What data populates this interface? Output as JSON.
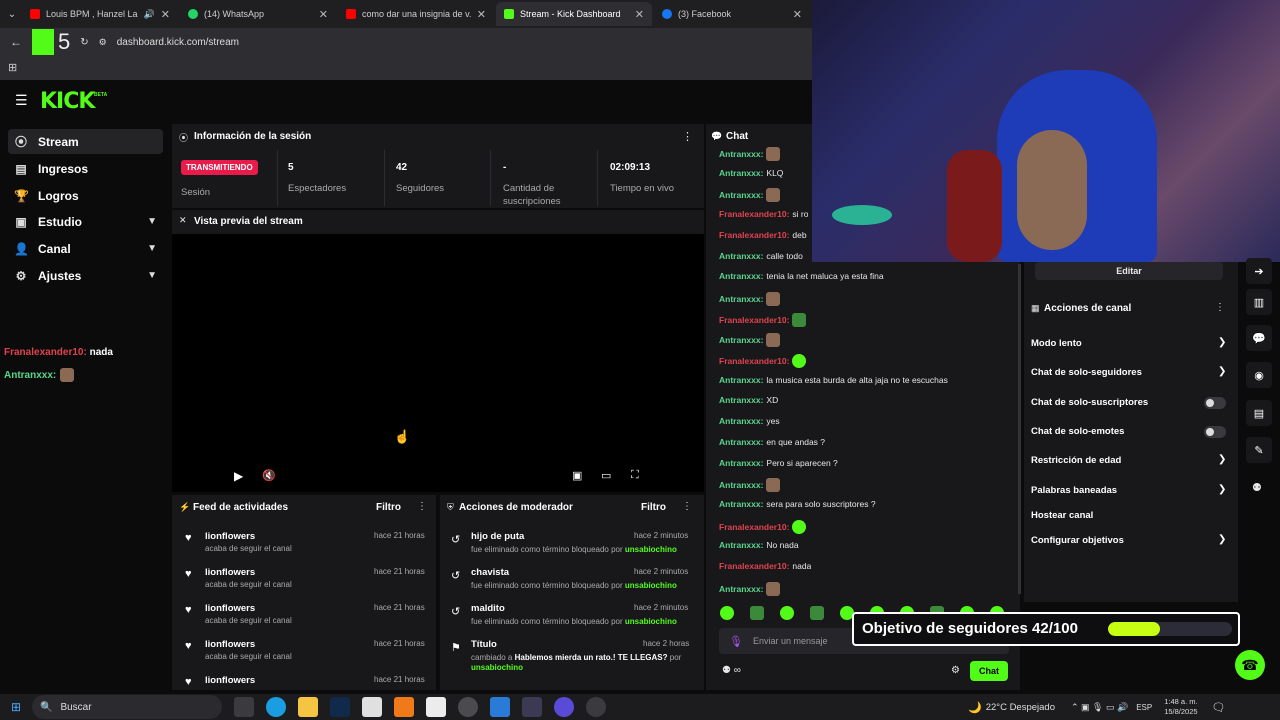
{
  "browser": {
    "tabs": [
      {
        "title": "Louis BPM , Hanzel La H, J...",
        "color": "#ff0000"
      },
      {
        "title": "(14) WhatsApp",
        "color": "#25d366"
      },
      {
        "title": "como dar una insignia de v...",
        "color": "#ff0000"
      },
      {
        "title": "Stream - Kick Dashboard",
        "color": "#53fc18"
      },
      {
        "title": "(3) Facebook",
        "color": "#1877f2"
      }
    ],
    "url": "dashboard.kick.com/stream",
    "overlay_number": "5"
  },
  "brand": {
    "logo": "KICK",
    "beta": "BETA",
    "accent": "#53fc18"
  },
  "sidebar": {
    "items": [
      {
        "label": "Stream",
        "icon": "broadcast-icon"
      },
      {
        "label": "Ingresos",
        "icon": "revenue-icon"
      },
      {
        "label": "Logros",
        "icon": "trophy-icon"
      },
      {
        "label": "Estudio",
        "icon": "studio-icon"
      },
      {
        "label": "Canal",
        "icon": "channel-icon"
      },
      {
        "label": "Ajustes",
        "icon": "gear-icon"
      }
    ]
  },
  "overlay_chat": [
    {
      "user": "Franalexander10:",
      "text": "nada"
    },
    {
      "user": "Antranxxx:",
      "text": ""
    }
  ],
  "session": {
    "title": "Información de la sesión",
    "live_badge": "TRANSMITIENDO",
    "live_label": "Sesión",
    "stats": [
      {
        "value": "5",
        "label": "Espectadores"
      },
      {
        "value": "42",
        "label": "Seguidores"
      },
      {
        "value": "-",
        "label": "Cantidad de suscripciones"
      },
      {
        "value": "02:09:13",
        "label": "Tiempo en vivo"
      }
    ]
  },
  "preview": {
    "title": "Vista previa del stream"
  },
  "feed": {
    "title": "Feed de actividades",
    "filter": "Filtro",
    "rows": [
      {
        "user": "lionflowers",
        "sub": "acaba de seguir el canal",
        "time": "hace 21 horas"
      },
      {
        "user": "lionflowers",
        "sub": "acaba de seguir el canal",
        "time": "hace 21 horas"
      },
      {
        "user": "lionflowers",
        "sub": "acaba de seguir el canal",
        "time": "hace 21 horas"
      },
      {
        "user": "lionflowers",
        "sub": "acaba de seguir el canal",
        "time": "hace 21 horas"
      },
      {
        "user": "lionflowers",
        "sub": "",
        "time": "hace 21 horas"
      }
    ]
  },
  "mod": {
    "title": "Acciones de moderador",
    "filter": "Filtro",
    "rows": [
      {
        "title": "hijo de puta",
        "sub": "fue eliminado como término bloqueado por",
        "by": "unsabiochino",
        "time": "hace 2 minutos"
      },
      {
        "title": "chavista",
        "sub": "fue eliminado como término bloqueado por",
        "by": "unsabiochino",
        "time": "hace 2 minutos"
      },
      {
        "title": "maldito",
        "sub": "fue eliminado como término bloqueado por",
        "by": "unsabiochino",
        "time": "hace 2 minutos"
      },
      {
        "title": "Título",
        "sub": "cambiado a",
        "sub_bold": "Hablemos mierda un rato.! TE LLEGAS?",
        "sub_end": "por",
        "by": "unsabiochino",
        "time": "hace 2 horas"
      }
    ]
  },
  "chat": {
    "title": "Chat",
    "messages": [
      {
        "user": "Antranxxx:",
        "color": "g",
        "text": "",
        "emote": "face"
      },
      {
        "user": "Antranxxx:",
        "color": "g",
        "text": "KLQ"
      },
      {
        "user": "Antranxxx:",
        "color": "g",
        "text": "",
        "emote": "face"
      },
      {
        "user": "Franalexander10:",
        "color": "r",
        "text": "si ro"
      },
      {
        "user": "Franalexander10:",
        "color": "r",
        "text": "deb"
      },
      {
        "user": "Antranxxx:",
        "color": "g",
        "text": "calle todo"
      },
      {
        "user": "Antranxxx:",
        "color": "g",
        "text": "tenia la net maluca ya esta fina"
      },
      {
        "user": "Antranxxx:",
        "color": "g",
        "text": "",
        "emote": "face"
      },
      {
        "user": "Franalexander10:",
        "color": "r",
        "text": "",
        "emote": "sq"
      },
      {
        "user": "Antranxxx:",
        "color": "g",
        "text": "",
        "emote": "face"
      },
      {
        "user": "Franalexander10:",
        "color": "r",
        "text": "",
        "emote": "green"
      },
      {
        "user": "Antranxxx:",
        "color": "g",
        "text": "la musica esta burda de alta jaja no te escuchas"
      },
      {
        "user": "Antranxxx:",
        "color": "g",
        "text": "XD"
      },
      {
        "user": "Antranxxx:",
        "color": "g",
        "text": "yes"
      },
      {
        "user": "Antranxxx:",
        "color": "g",
        "text": "en que andas ?"
      },
      {
        "user": "Antranxxx:",
        "color": "g",
        "text": "Pero si aparecen ?"
      },
      {
        "user": "Antranxxx:",
        "color": "g",
        "text": "",
        "emote": "face"
      },
      {
        "user": "Antranxxx:",
        "color": "g",
        "text": "sera para solo suscriptores ?"
      },
      {
        "user": "Franalexander10:",
        "color": "r",
        "text": "",
        "emote": "green"
      },
      {
        "user": "Antranxxx:",
        "color": "g",
        "text": "No nada"
      },
      {
        "user": "Franalexander10:",
        "color": "r",
        "text": "nada"
      },
      {
        "user": "Antranxxx:",
        "color": "g",
        "text": "",
        "emote": "face"
      }
    ],
    "input_placeholder": "Enviar un mensaje",
    "send_label": "Chat"
  },
  "channel_actions": {
    "edit_label": "Editar",
    "title": "Acciones de canal",
    "items": [
      {
        "label": "Modo lento",
        "control": "chevron"
      },
      {
        "label": "Chat de solo-seguidores",
        "control": "chevron"
      },
      {
        "label": "Chat de solo-suscriptores",
        "control": "toggle"
      },
      {
        "label": "Chat de solo-emotes",
        "control": "toggle"
      },
      {
        "label": "Restricción de edad",
        "control": "chevron"
      },
      {
        "label": "Palabras baneadas",
        "control": "chevron"
      },
      {
        "label": "Hostear canal",
        "control": "none"
      },
      {
        "label": "Configurar objetivos",
        "control": "chevron"
      }
    ]
  },
  "goal": {
    "label": "Objetivo de seguidores 42/100",
    "progress": 0.42
  },
  "taskbar": {
    "search": "Buscar",
    "weather": "22°C Despejado",
    "lang": "ESP",
    "time": "1:48 a. m.",
    "date": "15/8/2025"
  }
}
